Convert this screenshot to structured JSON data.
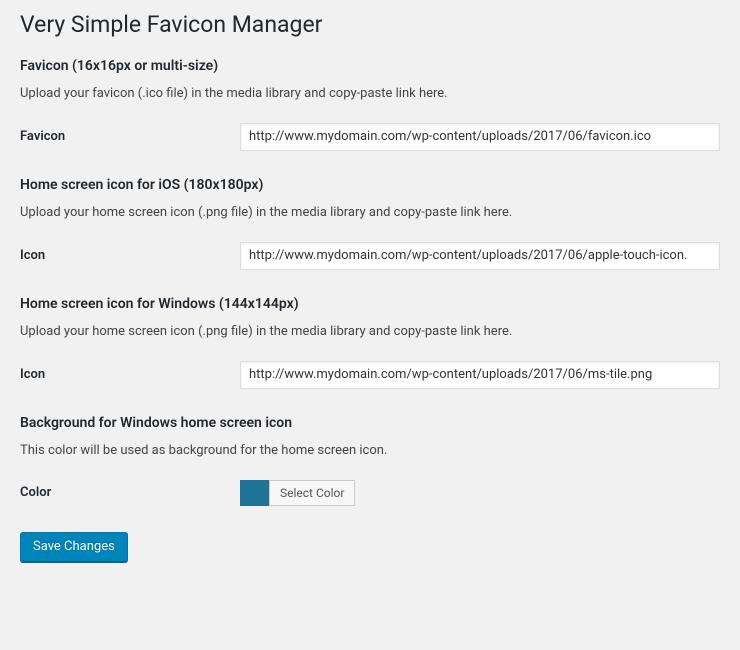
{
  "page": {
    "title": "Very Simple Favicon Manager"
  },
  "sections": {
    "favicon": {
      "heading": "Favicon (16x16px or multi-size)",
      "description": "Upload your favicon (.ico file) in the media library and copy-paste link here.",
      "label": "Favicon",
      "value": "http://www.mydomain.com/wp-content/uploads/2017/06/favicon.ico"
    },
    "ios": {
      "heading": "Home screen icon for iOS (180x180px)",
      "description": "Upload your home screen icon (.png file) in the media library and copy-paste link here.",
      "label": "Icon",
      "value": "http://www.mydomain.com/wp-content/uploads/2017/06/apple-touch-icon."
    },
    "windows": {
      "heading": "Home screen icon for Windows (144x144px)",
      "description": "Upload your home screen icon (.png file) in the media library and copy-paste link here.",
      "label": "Icon",
      "value": "http://www.mydomain.com/wp-content/uploads/2017/06/ms-tile.png"
    },
    "bgcolor": {
      "heading": "Background for Windows home screen icon",
      "description": "This color will be used as background for the home screen icon.",
      "label": "Color",
      "swatch": "#1e7397",
      "select_label": "Select Color"
    }
  },
  "actions": {
    "save": "Save Changes"
  }
}
